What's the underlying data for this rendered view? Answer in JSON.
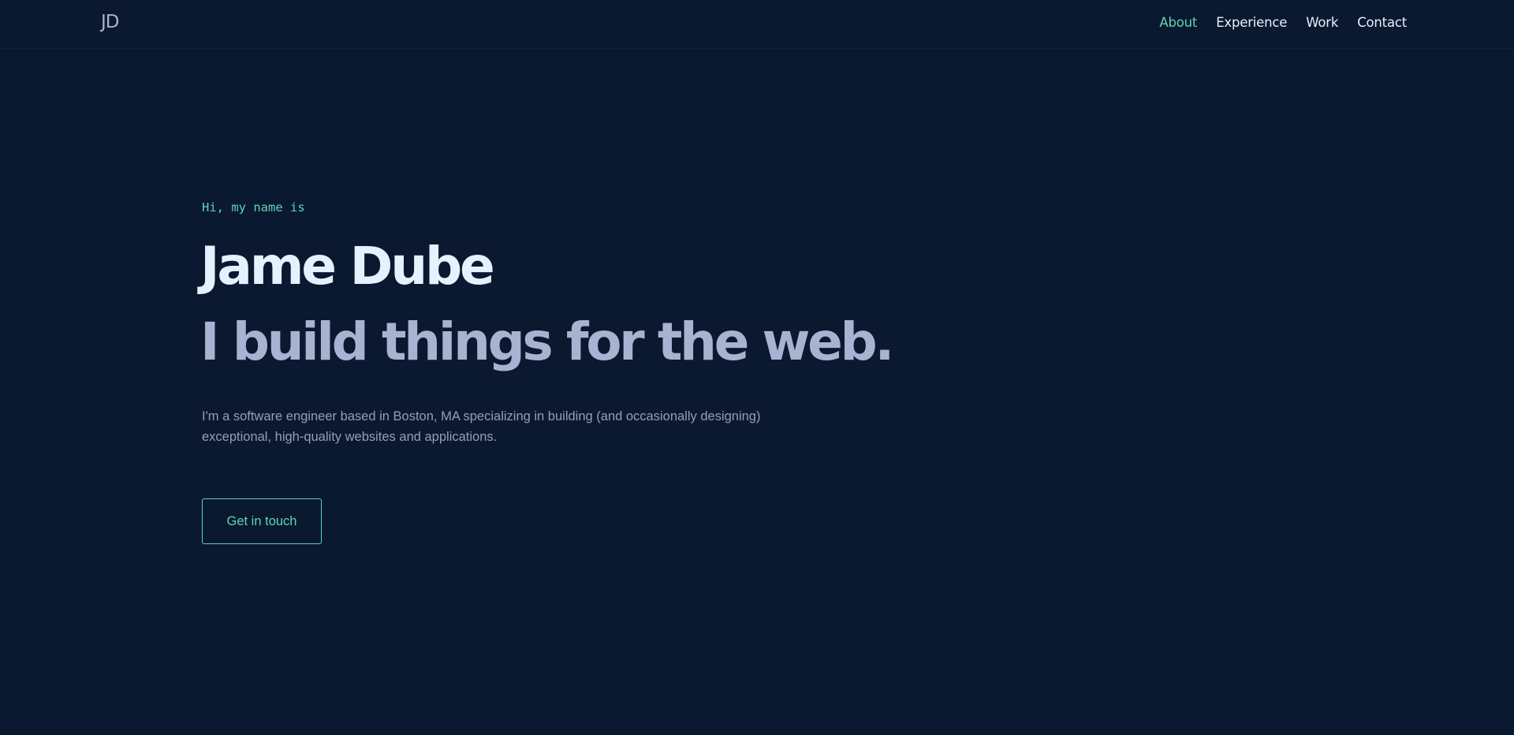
{
  "nav": {
    "logo": "JD",
    "links": [
      {
        "label": "About",
        "active": true
      },
      {
        "label": "Experience",
        "active": false
      },
      {
        "label": "Work",
        "active": false
      },
      {
        "label": "Contact",
        "active": false
      }
    ]
  },
  "hero": {
    "greeting": "Hi, my name is",
    "name": "Jame Dube",
    "tagline": "I build things for the web.",
    "intro": "I'm a software engineer based in Boston, MA specializing in building (and occasionally designing) exceptional, high-quality websites and applications.",
    "cta_label": "Get in touch"
  },
  "colors": {
    "background": "#0a192f",
    "accent": "#5fd3b4",
    "heading": "#e6f1ff",
    "subheading": "#a8b2d1",
    "body_text": "#8892b0"
  }
}
